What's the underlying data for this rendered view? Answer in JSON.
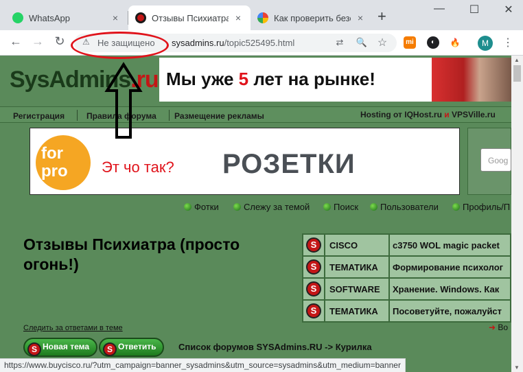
{
  "browser": {
    "tabs": [
      {
        "title": "WhatsApp",
        "close": "×",
        "favicon_color": "#25d366",
        "active": false
      },
      {
        "title": "Отзывы Психиатра (",
        "close": "×",
        "favicon_color": "#c41616",
        "active": true
      },
      {
        "title": "Как проверить безо",
        "close": "×",
        "favicon_color": "#4285f4",
        "active": false
      }
    ],
    "new_tab": "+",
    "window_controls": {
      "minimize": "—",
      "maximize": "☐",
      "close": "✕"
    },
    "nav": {
      "back": "←",
      "forward": "→",
      "reload": "↻"
    },
    "omnibox": {
      "security_icon": "⚠",
      "security_text": "Не защищено",
      "host": "sysadmins.ru",
      "path": "/topic525495.html"
    },
    "omnibox_icons": {
      "translate": "⇄",
      "zoom": "🔍",
      "bookmark": "☆"
    },
    "extensions": [
      {
        "name": "mi-extension-icon",
        "label": "mi",
        "color": "#f57c00"
      },
      {
        "name": "circle-extension-icon",
        "label": "◐",
        "color": "#202124"
      },
      {
        "name": "fire-extension-icon",
        "label": "🔥",
        "color": "#ffffff"
      }
    ],
    "profile_initial": "M",
    "menu": "⋮",
    "status_url": "https://www.buycisco.ru/?utm_campaign=banner_sysadmins&utm_source=sysadmins&utm_medium=banner"
  },
  "site": {
    "logo_main": "SysAdmins",
    "logo_suffix": ".ru",
    "banner_top": {
      "pre": "Мы уже ",
      "num": "5",
      "post": " лет на рынке!"
    },
    "navbar": {
      "items": [
        "Регистрация",
        "Правила форума",
        "Размещение рекламы"
      ],
      "hosting_prefix": "Hosting от IQHost.ru",
      "hosting_and": "и",
      "hosting_suffix": "VPSVille.ru"
    },
    "banner_mid": {
      "logo": "for pro",
      "question": "Эт чо так?",
      "brand": "РОЗЕТКИ"
    },
    "google_placeholder": "Goog",
    "user_links": [
      "Фотки",
      "Слежу за темой",
      "Поиск",
      "Пользователи",
      "Профиль/П"
    ],
    "topic_title": "Отзывы Психиатра (просто огонь!)",
    "topics": [
      {
        "category": "CISCO",
        "text": "c3750 WOL magic packet"
      },
      {
        "category": "ТЕМАТИКА",
        "text": "Формирование психолог"
      },
      {
        "category": "SOFTWARE",
        "text": "Хранение. Windows. Как"
      },
      {
        "category": "ТЕМАТИКА",
        "text": "Посоветуйте, пожалуйст"
      }
    ],
    "topic_icon": "S",
    "follow_link": "Следить за ответами в теме",
    "more_link": "Во",
    "buttons": {
      "new_topic": "Новая тема",
      "reply": "Ответить"
    },
    "forum_path": "Список форумов SYSAdmins.RU -> Курилка"
  }
}
